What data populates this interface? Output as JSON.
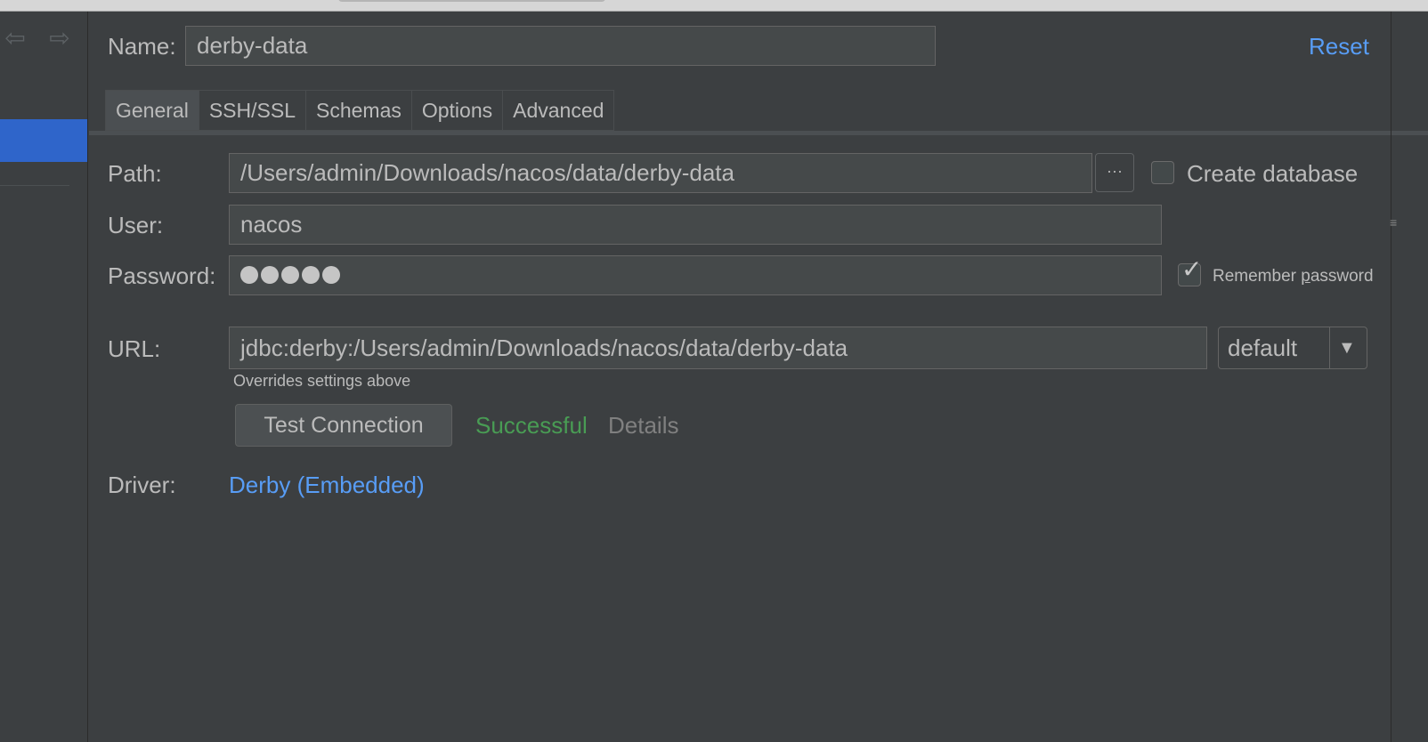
{
  "form": {
    "name_label": "Name:",
    "name_value": "derby-data",
    "reset_label": "Reset",
    "tabs": [
      {
        "label": "General",
        "active": true
      },
      {
        "label": "SSH/SSL",
        "active": false
      },
      {
        "label": "Schemas",
        "active": false
      },
      {
        "label": "Options",
        "active": false
      },
      {
        "label": "Advanced",
        "active": false
      }
    ],
    "path_label": "Path:",
    "path_value": "/Users/admin/Downloads/nacos/data/derby-data",
    "browse_label": "···",
    "create_db_label": "Create database",
    "create_db_checked": false,
    "user_label": "User:",
    "user_value": "nacos",
    "password_label": "Password:",
    "password_dots": 5,
    "remember_label_pre": "Remember ",
    "remember_label_mnemonic": "p",
    "remember_label_post": "assword",
    "remember_checked": true,
    "url_label": "URL:",
    "url_value": "jdbc:derby:/Users/admin/Downloads/nacos/data/derby-data",
    "url_mode": "default",
    "url_hint": "Overrides settings above",
    "test_button_label": "Test Connection",
    "test_status": "Successful",
    "details_label": "Details",
    "driver_label": "Driver:",
    "driver_value": "Derby (Embedded)"
  },
  "colors": {
    "background": "#3c3f41",
    "selection": "#2f65ca",
    "link": "#589df6",
    "success": "#499c54"
  },
  "icons": {
    "back": "arrow-left-icon",
    "forward": "arrow-right-icon",
    "dropdown": "chevron-down-icon",
    "check": "checkmark-icon"
  }
}
